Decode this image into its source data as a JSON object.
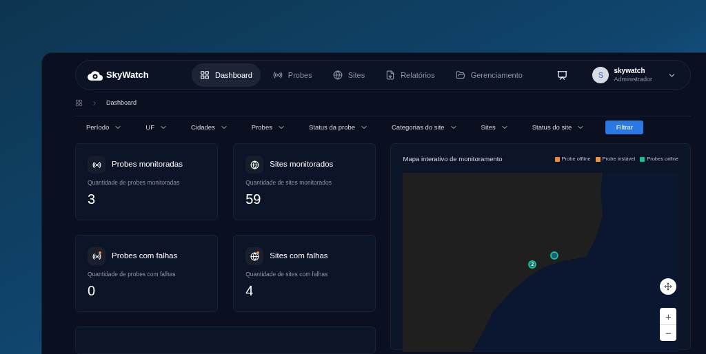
{
  "nav": {
    "brand": "SkyWatch",
    "items": [
      {
        "label": "Dashboard",
        "kind": "grid",
        "selected": true
      },
      {
        "label": "Probes",
        "kind": "radio",
        "selected": false
      },
      {
        "label": "Sites",
        "kind": "globe",
        "selected": false
      },
      {
        "label": "Relatórios",
        "kind": "report",
        "selected": false
      },
      {
        "label": "Gerenciamento",
        "kind": "folder",
        "selected": false
      }
    ],
    "user": {
      "initial": "S",
      "name": "skywatch",
      "role": "Administrador"
    }
  },
  "breadcrumb": [
    "Dashboard"
  ],
  "filters": [
    "Período",
    "UF",
    "Cidades",
    "Probes",
    "Status da probe",
    "Categorias do site",
    "Sites",
    "Status do site"
  ],
  "filter_button": "Filtrar",
  "stats": [
    {
      "kind": "radio",
      "alert": false,
      "title": "Probes monitoradas",
      "subtitle": "Quantidade de probes monitoradas",
      "value": "3"
    },
    {
      "kind": "globe",
      "alert": false,
      "title": "Sites monitorados",
      "subtitle": "Quantidade de sites monitorados",
      "value": "59"
    },
    {
      "kind": "radio",
      "alert": true,
      "title": "Probes com falhas",
      "subtitle": "Quantidade de probes com falhas",
      "value": "0"
    },
    {
      "kind": "globe",
      "alert": true,
      "title": "Sites com falhas",
      "subtitle": "Quantidade de sites com falhas",
      "value": "4"
    }
  ],
  "map": {
    "title": "Mapa interativo de monitoramento",
    "legend": [
      {
        "label": "Probe offline",
        "color": "#ee8a3a"
      },
      {
        "label": "Probe instável",
        "color": "#f39440"
      },
      {
        "label": "Probes online",
        "color": "#12c493"
      }
    ],
    "markers": [
      {
        "kind": "cluster",
        "count": "2"
      },
      {
        "kind": "single"
      }
    ],
    "zoom_in": "+",
    "zoom_out": "−"
  }
}
